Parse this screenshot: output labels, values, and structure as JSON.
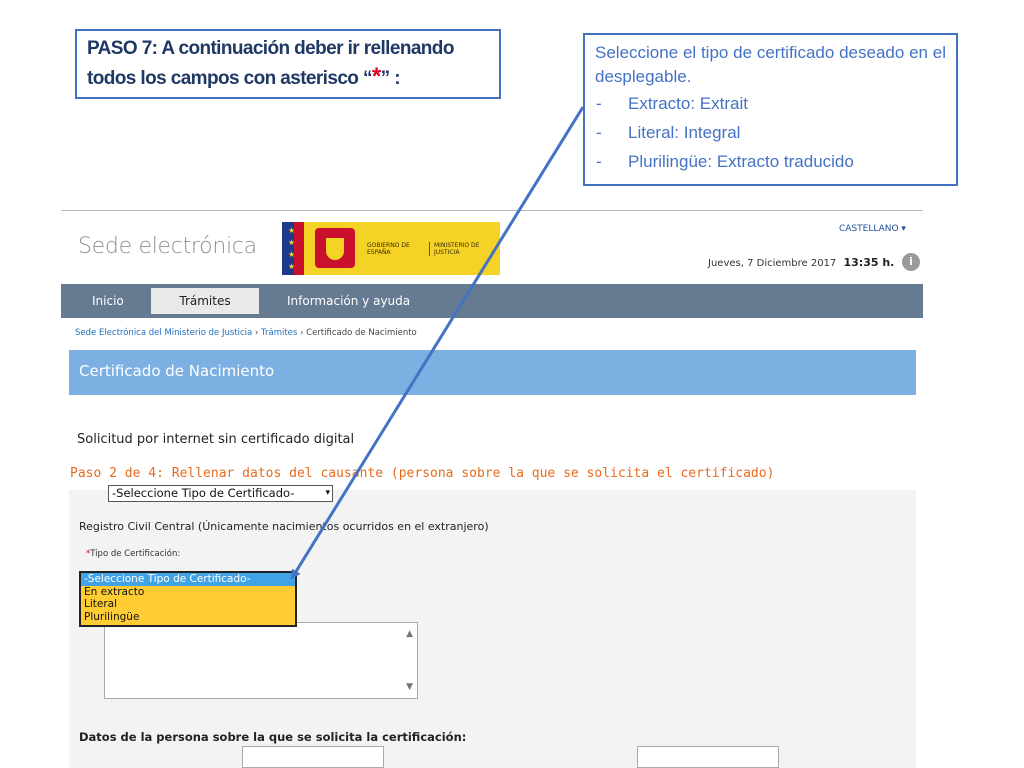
{
  "annotation": {
    "step_title": "PASO 7: A continuación deber ir rellenando todos los campos con asterisco",
    "step_title_quote_open": "“",
    "step_title_asterisk": "*",
    "step_title_quote_close": "”",
    "step_title_colon": " :",
    "info_intro": "Seleccione el tipo de certificado deseado en el desplegable.",
    "info_items": [
      "Extracto: Extrait",
      "Literal: Integral",
      "Plurilingüe: Extracto traducido"
    ]
  },
  "header": {
    "brand_title": "Sede electrónica",
    "logo_left_text": "GOBIERNO DE ESPAÑA",
    "logo_right_text": "MINISTERIO DE JUSTICIA",
    "language": "CASTELLANO ▾",
    "date": "Jueves, 7 Diciembre 2017",
    "time": "13:35 h.",
    "info_icon": "i"
  },
  "nav": {
    "items": [
      "Inicio",
      "Trámites",
      "Información y ayuda"
    ],
    "active_index": 1
  },
  "breadcrumb": {
    "link1": "Sede Electrónica del Ministerio de Justicia",
    "sep": " › ",
    "link2": "Trámites",
    "current": "Certificado de Nacimiento"
  },
  "banner": {
    "title": "Certificado de Nacimiento"
  },
  "main": {
    "subtitle": "Solicitud por internet sin certificado digital",
    "step_line": "Paso 2 de 4: Rellenar datos del causante (persona sobre la que se solicita el certificado)",
    "top_select_value": "-Seleccione Tipo de Certificado-",
    "registro_label": "Registro Civil Central (Únicamente nacimientos ocurridos en el extranjero)",
    "tipo_required": "*",
    "tipo_label": "Tipo de Certificación:",
    "dropdown_options": [
      "-Seleccione Tipo de Certificado-",
      "En extracto",
      "Literal",
      "Plurilingüe"
    ],
    "dropdown_selected_index": 0,
    "datos_label": "Datos de la persona sobre la que se solicita la certificación:"
  },
  "colors": {
    "annotation_border": "#4472c4",
    "navbar": "#667a92",
    "banner": "#7cb0e3",
    "step_orange": "#ea6a1c",
    "dropdown_bg": "#ffcd33",
    "dropdown_selected": "#41a3e5"
  }
}
